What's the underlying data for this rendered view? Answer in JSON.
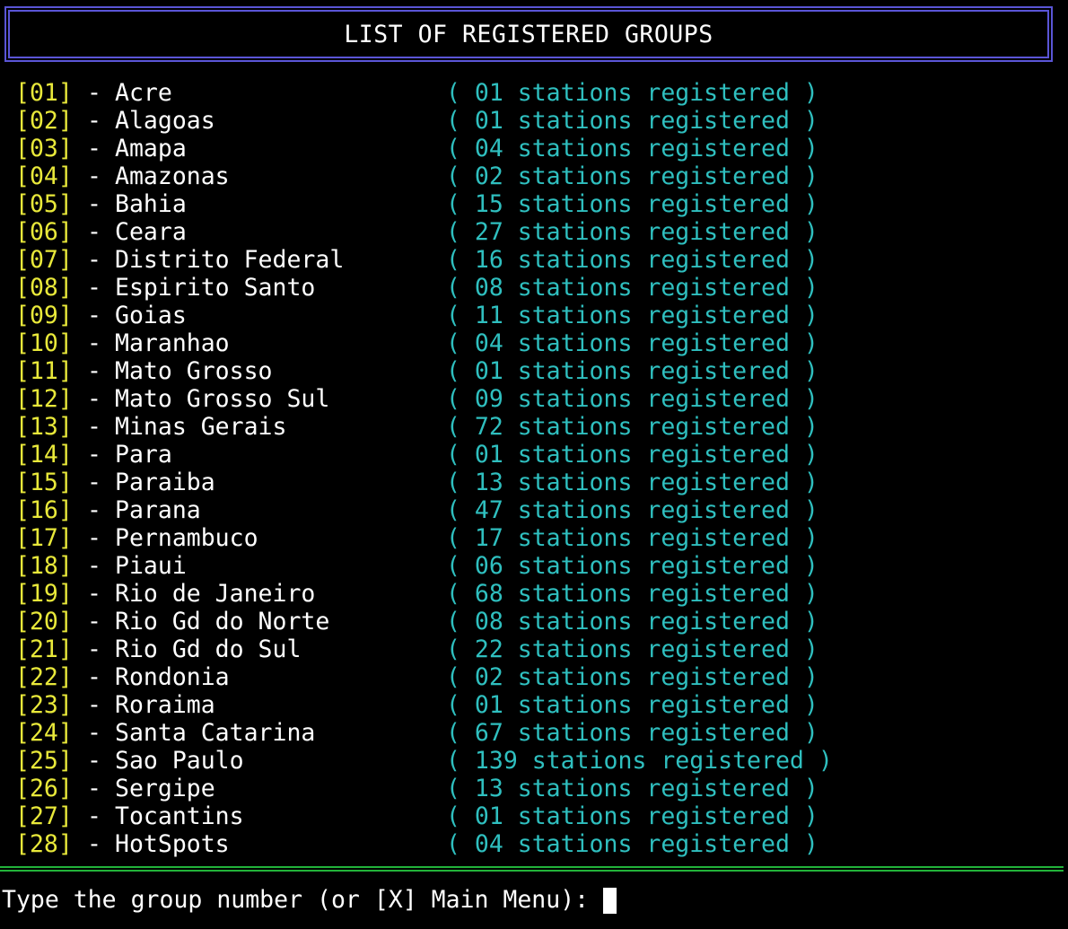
{
  "header": {
    "title": "LIST OF REGISTERED GROUPS"
  },
  "groups": [
    {
      "num": "[01]",
      "name": "Acre",
      "count": "( 01 stations registered )"
    },
    {
      "num": "[02]",
      "name": "Alagoas",
      "count": "( 01 stations registered )"
    },
    {
      "num": "[03]",
      "name": "Amapa",
      "count": "( 04 stations registered )"
    },
    {
      "num": "[04]",
      "name": "Amazonas",
      "count": "( 02 stations registered )"
    },
    {
      "num": "[05]",
      "name": "Bahia",
      "count": "( 15 stations registered )"
    },
    {
      "num": "[06]",
      "name": "Ceara",
      "count": "( 27 stations registered )"
    },
    {
      "num": "[07]",
      "name": "Distrito Federal",
      "count": "( 16 stations registered )"
    },
    {
      "num": "[08]",
      "name": "Espirito Santo",
      "count": "( 08 stations registered )"
    },
    {
      "num": "[09]",
      "name": "Goias",
      "count": "( 11 stations registered )"
    },
    {
      "num": "[10]",
      "name": "Maranhao",
      "count": "( 04 stations registered )"
    },
    {
      "num": "[11]",
      "name": "Mato Grosso",
      "count": "( 01 stations registered )"
    },
    {
      "num": "[12]",
      "name": "Mato Grosso Sul",
      "count": "( 09 stations registered )"
    },
    {
      "num": "[13]",
      "name": "Minas Gerais",
      "count": "( 72 stations registered )"
    },
    {
      "num": "[14]",
      "name": "Para",
      "count": "( 01 stations registered )"
    },
    {
      "num": "[15]",
      "name": "Paraiba",
      "count": "( 13 stations registered )"
    },
    {
      "num": "[16]",
      "name": "Parana",
      "count": "( 47 stations registered )"
    },
    {
      "num": "[17]",
      "name": "Pernambuco",
      "count": "( 17 stations registered )"
    },
    {
      "num": "[18]",
      "name": "Piaui",
      "count": "( 06 stations registered )"
    },
    {
      "num": "[19]",
      "name": "Rio de Janeiro",
      "count": "( 68 stations registered )"
    },
    {
      "num": "[20]",
      "name": "Rio Gd do Norte",
      "count": "( 08 stations registered )"
    },
    {
      "num": "[21]",
      "name": "Rio Gd do Sul",
      "count": "( 22 stations registered )"
    },
    {
      "num": "[22]",
      "name": "Rondonia",
      "count": "( 02 stations registered )"
    },
    {
      "num": "[23]",
      "name": "Roraima",
      "count": "( 01 stations registered )"
    },
    {
      "num": "[24]",
      "name": "Santa Catarina",
      "count": "( 67 stations registered )"
    },
    {
      "num": "[25]",
      "name": "Sao Paulo",
      "count": "( 139 stations registered )"
    },
    {
      "num": "[26]",
      "name": "Sergipe",
      "count": "( 13 stations registered )"
    },
    {
      "num": "[27]",
      "name": "Tocantins",
      "count": "( 01 stations registered )"
    },
    {
      "num": "[28]",
      "name": "HotSpots",
      "count": "( 04 stations registered )"
    }
  ],
  "separator": "-",
  "prompt": {
    "text": "Type the group number (or [X] Main Menu):"
  },
  "colors": {
    "background": "#000000",
    "title_border": "#5a55d6",
    "number": "#e8e83a",
    "name": "#ffffff",
    "count": "#2fbfbf",
    "divider": "#22b33a"
  }
}
